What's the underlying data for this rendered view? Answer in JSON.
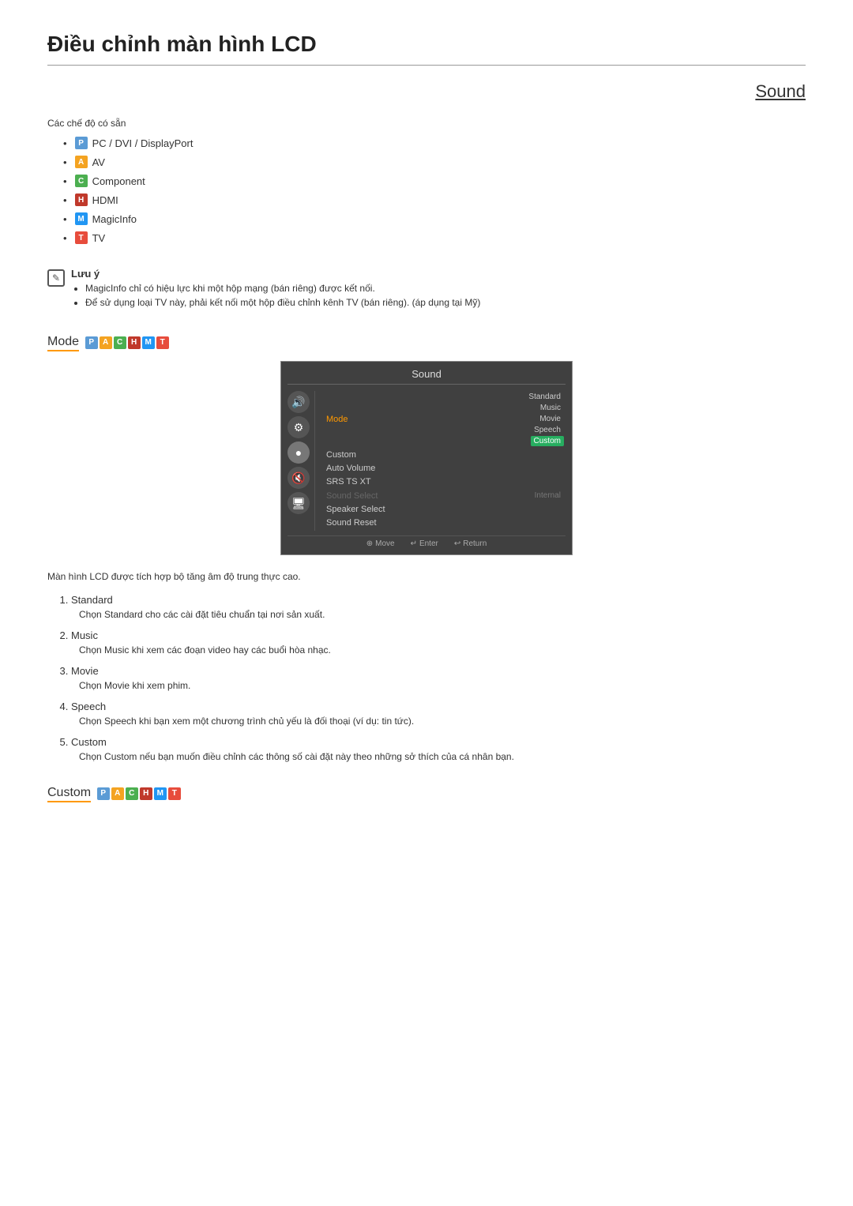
{
  "page": {
    "title": "Điều chỉnh màn hình LCD",
    "sound_heading": "Sound"
  },
  "modes_section": {
    "available_modes_label": "Các chế độ có sẵn",
    "modes": [
      {
        "badge": "P",
        "label": "PC / DVI / DisplayPort",
        "color": "b-p"
      },
      {
        "badge": "A",
        "label": "AV",
        "color": "b-a"
      },
      {
        "badge": "C",
        "label": "Component",
        "color": "b-c"
      },
      {
        "badge": "H",
        "label": "HDMI",
        "color": "b-h"
      },
      {
        "badge": "M",
        "label": "MagicInfo",
        "color": "b-m"
      },
      {
        "badge": "T",
        "label": "TV",
        "color": "b-t"
      }
    ]
  },
  "note": {
    "title": "Lưu ý",
    "icon_symbol": "✎",
    "bullets": [
      "MagicInfo chỉ có hiệu lực khi một hộp mạng (bán riêng) được kết nối.",
      "Để sử dụng loại TV này, phải kết nối một hộp điều chỉnh kênh TV (bán riêng). (áp dụng tại Mỹ)"
    ]
  },
  "osd": {
    "title": "Sound",
    "rows": [
      {
        "label": "Mode",
        "highlighted": true
      },
      {
        "label": "Custom"
      },
      {
        "label": "Auto Volume"
      },
      {
        "label": "SRS TS XT"
      },
      {
        "label": "Sound Select",
        "dimmed": true
      },
      {
        "label": "Speaker Select"
      },
      {
        "label": "Sound Reset"
      }
    ],
    "values": [
      "Standard",
      "Music",
      "Movie",
      "Speech",
      "Custom",
      "Internal"
    ],
    "selected_value": "Custom",
    "footer": [
      {
        "icon": "⊕",
        "label": "Move"
      },
      {
        "icon": "↵",
        "label": "Enter"
      },
      {
        "icon": "↩",
        "label": "Return"
      }
    ]
  },
  "mode_section": {
    "title": "Mode",
    "badges": [
      {
        "letter": "P",
        "cls": "b-p"
      },
      {
        "letter": "A",
        "cls": "b-a"
      },
      {
        "letter": "C",
        "cls": "b-c"
      },
      {
        "letter": "H",
        "cls": "b-h"
      },
      {
        "letter": "M",
        "cls": "b-m"
      },
      {
        "letter": "T",
        "cls": "b-t"
      }
    ],
    "description": "Màn hình LCD được tích hợp bộ tăng âm độ trung thực cao.",
    "items": [
      {
        "number": "1",
        "title": "Standard",
        "desc": "Chọn Standard cho các cài đặt tiêu chuẩn tại nơi sản xuất."
      },
      {
        "number": "2",
        "title": "Music",
        "desc": "Chọn Music khi xem các đoạn video hay các buổi hòa nhạc."
      },
      {
        "number": "3",
        "title": "Movie",
        "desc": "Chọn Movie khi xem phim."
      },
      {
        "number": "4",
        "title": "Speech",
        "desc": "Chọn Speech khi bạn xem một chương trình chủ yếu là đối thoại (ví dụ: tin tức)."
      },
      {
        "number": "5",
        "title": "Custom",
        "desc": "Chọn Custom nếu bạn muốn điều chỉnh các thông số cài đặt này theo những sở thích của cá nhân bạn."
      }
    ]
  },
  "custom_section": {
    "title": "Custom",
    "badges": [
      {
        "letter": "P",
        "cls": "b-p"
      },
      {
        "letter": "A",
        "cls": "b-a"
      },
      {
        "letter": "C",
        "cls": "b-c"
      },
      {
        "letter": "H",
        "cls": "b-h"
      },
      {
        "letter": "M",
        "cls": "b-m"
      },
      {
        "letter": "T",
        "cls": "b-t"
      }
    ]
  }
}
